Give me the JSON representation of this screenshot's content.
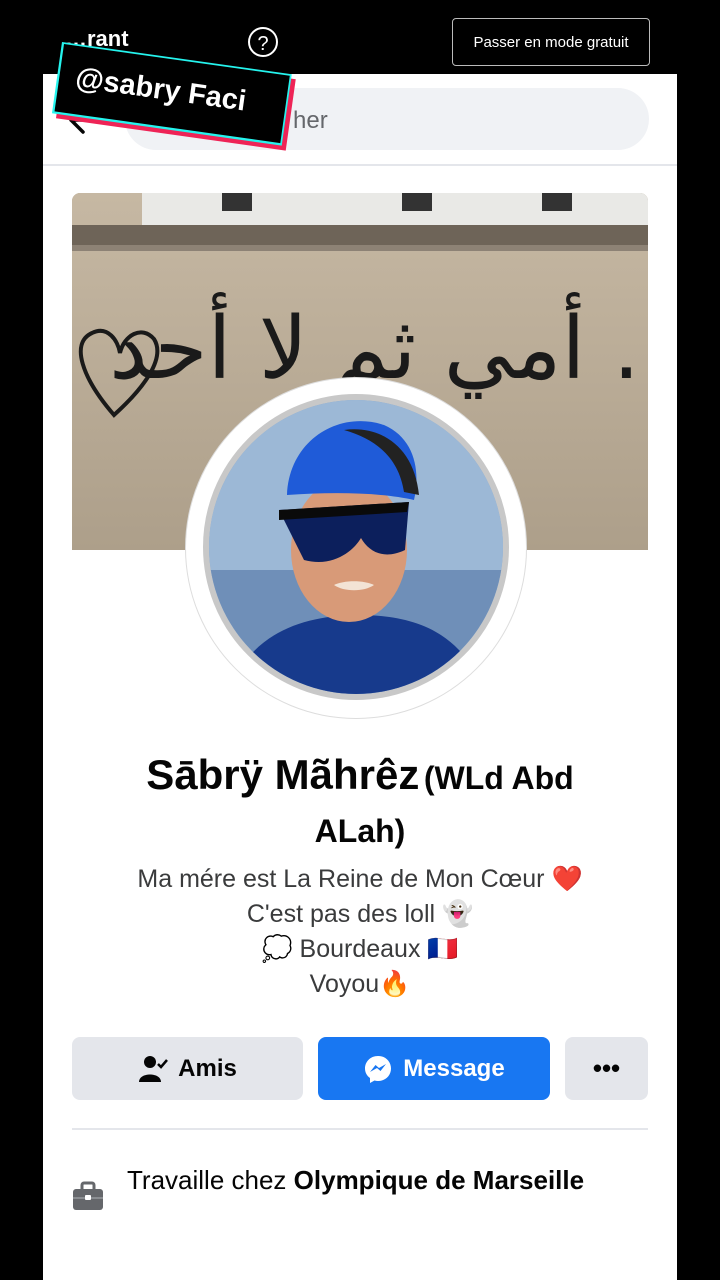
{
  "topbar": {
    "title_partial": "…rant",
    "help_glyph": "?",
    "free_mode_label": "Passer en mode gratuit"
  },
  "search": {
    "placeholder_visible": "her"
  },
  "cover": {
    "graffiti_text": "أمي ثم لا أحد ..."
  },
  "profile": {
    "name": "Sābrÿ Mãhrêz",
    "name_suffix_line1": "(WLd Abd",
    "name_suffix_line2": "ALah)",
    "bio": [
      "Ma mére est La Reine de Mon Cœur ❤️",
      "C'est pas des loll 👻",
      "💭 Bourdeaux 🇫🇷",
      "Voyou🔥"
    ]
  },
  "actions": {
    "friends_label": "Amis",
    "message_label": "Message",
    "more_label": "•••"
  },
  "work": {
    "prefix": "Travaille chez ",
    "employer": "Olympique de Marseille"
  },
  "watermark": {
    "text": "@sabry Faci"
  },
  "colors": {
    "primary": "#1877f2",
    "button_gray": "#e4e6eb"
  }
}
